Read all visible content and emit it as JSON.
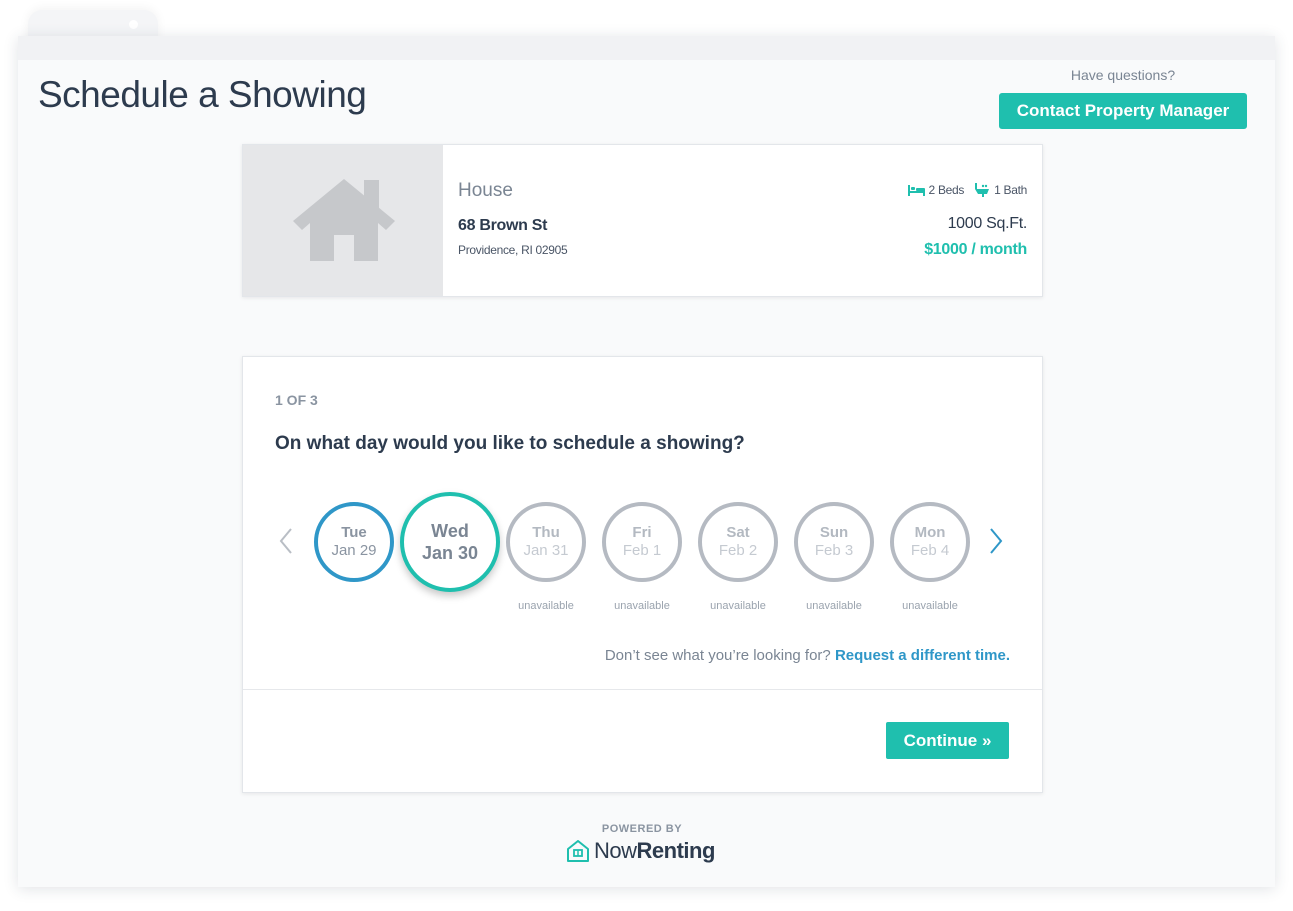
{
  "header": {
    "title": "Schedule a Showing",
    "help_label": "Have questions?",
    "contact_button": "Contact Property Manager"
  },
  "property": {
    "type": "House",
    "street": "68 Brown St",
    "city": "Providence, RI 02905",
    "beds": "2 Beds",
    "baths": "1 Bath",
    "sqft": "1000 Sq.Ft.",
    "rent": "$1000 / month"
  },
  "schedule": {
    "step": "1 OF 3",
    "question": "On what day would you like to schedule a showing?",
    "days": [
      {
        "name": "Tue",
        "date": "Jan 29",
        "status": "available"
      },
      {
        "name": "Wed",
        "date": "Jan 30",
        "status": "selected"
      },
      {
        "name": "Thu",
        "date": "Jan 31",
        "status": "unavailable"
      },
      {
        "name": "Fri",
        "date": "Feb 1",
        "status": "unavailable"
      },
      {
        "name": "Sat",
        "date": "Feb 2",
        "status": "unavailable"
      },
      {
        "name": "Sun",
        "date": "Feb 3",
        "status": "unavailable"
      },
      {
        "name": "Mon",
        "date": "Feb 4",
        "status": "unavailable"
      }
    ],
    "unavailable_label": "unavailable",
    "prompt_text": "Don’t see what you’re looking for?",
    "prompt_link": "Request a different time.",
    "continue_button": "Continue »"
  },
  "footer": {
    "powered_by": "POWERED BY",
    "brand_part1": "Now",
    "brand_part2": "Renting"
  },
  "icons": {
    "prev": "chevron-left-icon",
    "next": "chevron-right-icon",
    "bed": "bed-icon",
    "bath": "bath-icon",
    "house": "house-icon",
    "logo": "nowrenting-logo-icon"
  },
  "colors": {
    "accent": "#1fbfae",
    "link": "#2f97c8",
    "unavailable": "#b5bac2"
  }
}
